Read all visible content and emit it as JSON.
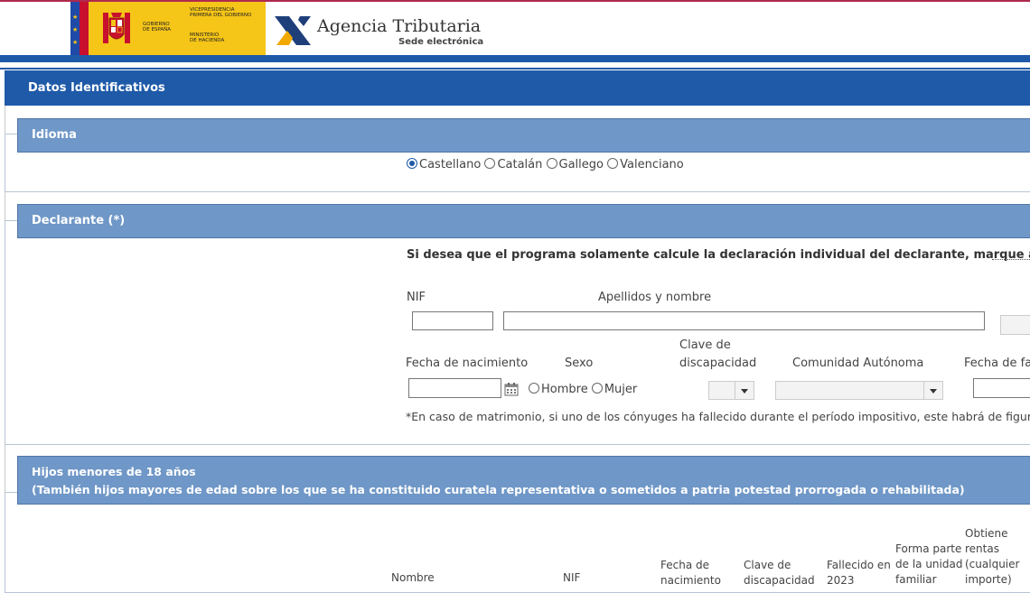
{
  "header": {
    "gov_text1": [
      "GOBIERNO",
      "DE ESPAÑA"
    ],
    "gov_text2": [
      "VICEPRESIDENCIA",
      "PRIMERA DEL GOBIERNO"
    ],
    "gov_text3": [
      "MINISTERIO",
      "DE HACIENDA"
    ],
    "agency_name": "Agencia Tributaria",
    "agency_sub": "Sede electrónica"
  },
  "section_title": "Datos Identificativos",
  "idioma": {
    "title": "Idioma",
    "options": [
      {
        "label": "Castellano",
        "selected": true
      },
      {
        "label": "Catalán",
        "selected": false
      },
      {
        "label": "Gallego",
        "selected": false
      },
      {
        "label": "Valenciano",
        "selected": false
      }
    ]
  },
  "declarante": {
    "title": "Declarante (*)",
    "individual_note": "Si desea que el programa solamente calcule la declaración individual del declarante, marque aquí",
    "nif_label": "NIF",
    "apellidos_label": "Apellidos y nombre",
    "fecha_nac_label": "Fecha de nacimiento",
    "sexo_label": "Sexo",
    "sexo_options": [
      "Hombre",
      "Mujer"
    ],
    "clave_disc_label_1": "Clave de",
    "clave_disc_label_2": "discapacidad",
    "comunidad_label": "Comunidad Autónoma",
    "fecha_fall_label": "Fecha de fal",
    "footnote": "*En caso de matrimonio, si uno de los cónyuges ha fallecido durante el período impositivo, este habrá de figura"
  },
  "hijos": {
    "title_1": "Hijos menores de 18 años",
    "title_2": "(También hijos mayores de edad sobre los que se ha constituido curatela representativa o sometidos a patria potestad prorrogada o rehabilitada)",
    "columns": {
      "nombre": "Nombre",
      "nif": "NIF",
      "fecha": [
        "Fecha de",
        "nacimiento"
      ],
      "clave": [
        "Clave de",
        "discapacidad"
      ],
      "fallecido": [
        "Fallecido en",
        "2023"
      ],
      "forma": [
        "Forma parte",
        "de la unidad",
        "familiar"
      ],
      "obtiene": [
        "Obtiene",
        "rentas",
        "(cualquier",
        "importe)"
      ]
    }
  }
}
